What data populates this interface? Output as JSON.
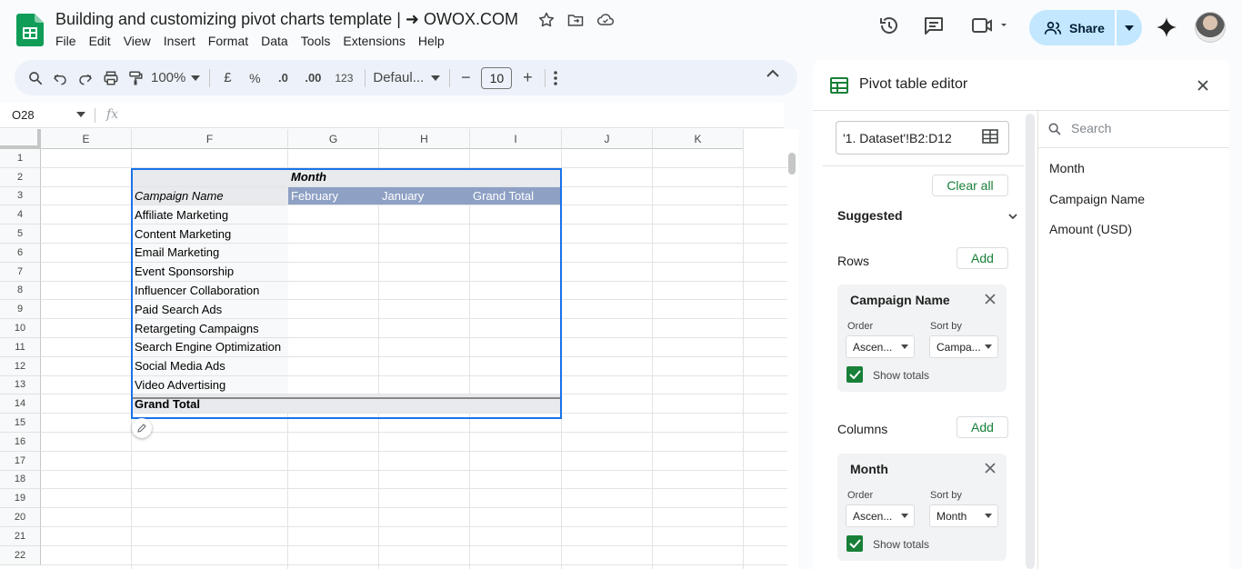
{
  "header": {
    "title": "Building and customizing pivot charts template | ➜ OWOX.COM",
    "menu": [
      "File",
      "Edit",
      "View",
      "Insert",
      "Format",
      "Data",
      "Tools",
      "Extensions",
      "Help"
    ],
    "share_label": "Share"
  },
  "toolbar": {
    "zoom": "100%",
    "currency": "£",
    "percent": "%",
    "dec_decrease": ".0",
    "dec_increase": ".00",
    "number_format": "123",
    "font": "Defaul...",
    "font_size": "10",
    "minus": "−",
    "plus": "+"
  },
  "formula_bar": {
    "cell_ref": "O28",
    "fx": "fx"
  },
  "grid": {
    "columns": [
      "E",
      "F",
      "G",
      "H",
      "I",
      "J",
      "K"
    ],
    "rows": [
      "1",
      "2",
      "3",
      "4",
      "5",
      "6",
      "7",
      "8",
      "9",
      "10",
      "11",
      "12",
      "13",
      "14",
      "15",
      "16",
      "17",
      "18",
      "19",
      "20",
      "21",
      "22"
    ],
    "pivot": {
      "month_header": "Month",
      "row_header": "Campaign Name",
      "col_values": [
        "February",
        "January",
        "Grand Total"
      ],
      "row_values": [
        "Affiliate Marketing",
        "Content Marketing",
        "Email Marketing",
        "Event Sponsorship",
        "Influencer Collaboration",
        "Paid Search Ads",
        "Retargeting Campaigns",
        "Search Engine Optimization",
        "Social Media Ads",
        "Video Advertising"
      ],
      "grand_total": "Grand Total"
    }
  },
  "panel": {
    "title": "Pivot table editor",
    "range": "'1. Dataset'!B2:D12",
    "clear_all": "Clear all",
    "suggested": "Suggested",
    "rows_label": "Rows",
    "columns_label": "Columns",
    "add_label": "Add",
    "row_card": {
      "title": "Campaign Name",
      "order_label": "Order",
      "order_value": "Ascen...",
      "sortby_label": "Sort by",
      "sortby_value": "Campa...",
      "show_totals": "Show totals"
    },
    "col_card": {
      "title": "Month",
      "order_label": "Order",
      "order_value": "Ascen...",
      "sortby_label": "Sort by",
      "sortby_value": "Month",
      "show_totals": "Show totals"
    },
    "search_placeholder": "Search",
    "fields": [
      "Month",
      "Campaign Name",
      "Amount (USD)"
    ]
  },
  "colors": {
    "accent": "#1a73e8",
    "pivot_header": "#8ea0c4",
    "pivot_label_bg": "#e8eaed",
    "share_bg": "#c2e7ff",
    "check_green": "#188038"
  }
}
